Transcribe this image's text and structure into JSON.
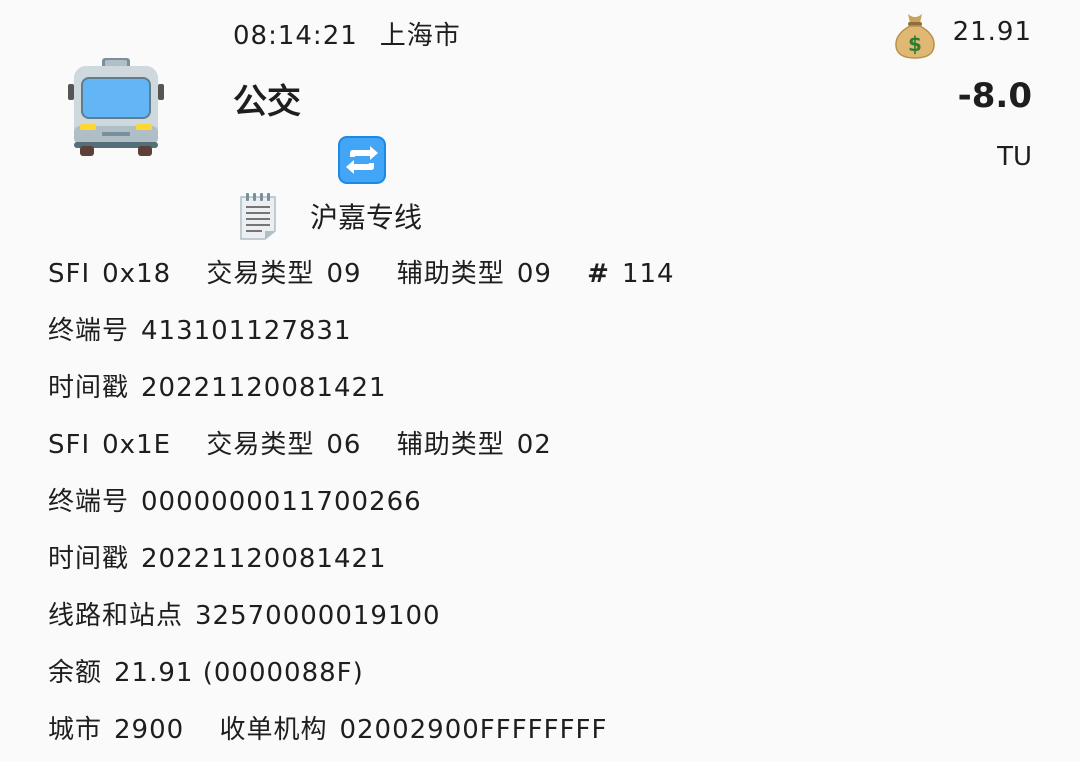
{
  "header": {
    "time": "08:14:21",
    "city": "上海市",
    "type": "公交",
    "route": "沪嘉专线",
    "balance": "21.91",
    "amount": "-8.0",
    "unit": "TU"
  },
  "icons": {
    "bus": "oncoming-bus-icon",
    "swap": "counterclockwise-arrows-icon",
    "memo": "memo-icon",
    "money": "money-bag-icon"
  },
  "record1": {
    "sfi_label": "SFI",
    "sfi": "0x18",
    "tx_type_label": "交易类型",
    "tx_type": "09",
    "aux_type_label": "辅助类型",
    "aux_type": "09",
    "hash": "#",
    "seq": "114",
    "terminal_label": "终端号",
    "terminal": "413101127831",
    "timestamp_label": "时间戳",
    "timestamp": "20221120081421"
  },
  "record2": {
    "sfi_label": "SFI",
    "sfi": "0x1E",
    "tx_type_label": "交易类型",
    "tx_type": "06",
    "aux_type_label": "辅助类型",
    "aux_type": "02",
    "terminal_label": "终端号",
    "terminal": "0000000011700266",
    "timestamp_label": "时间戳",
    "timestamp": "20221120081421",
    "line_label": "线路和站点",
    "line": "32570000019100",
    "balance_label": "余额",
    "balance": "21.91 (0000088F)",
    "city_label": "城市",
    "city": "2900",
    "acquirer_label": "收单机构",
    "acquirer": "02002900FFFFFFFF"
  }
}
